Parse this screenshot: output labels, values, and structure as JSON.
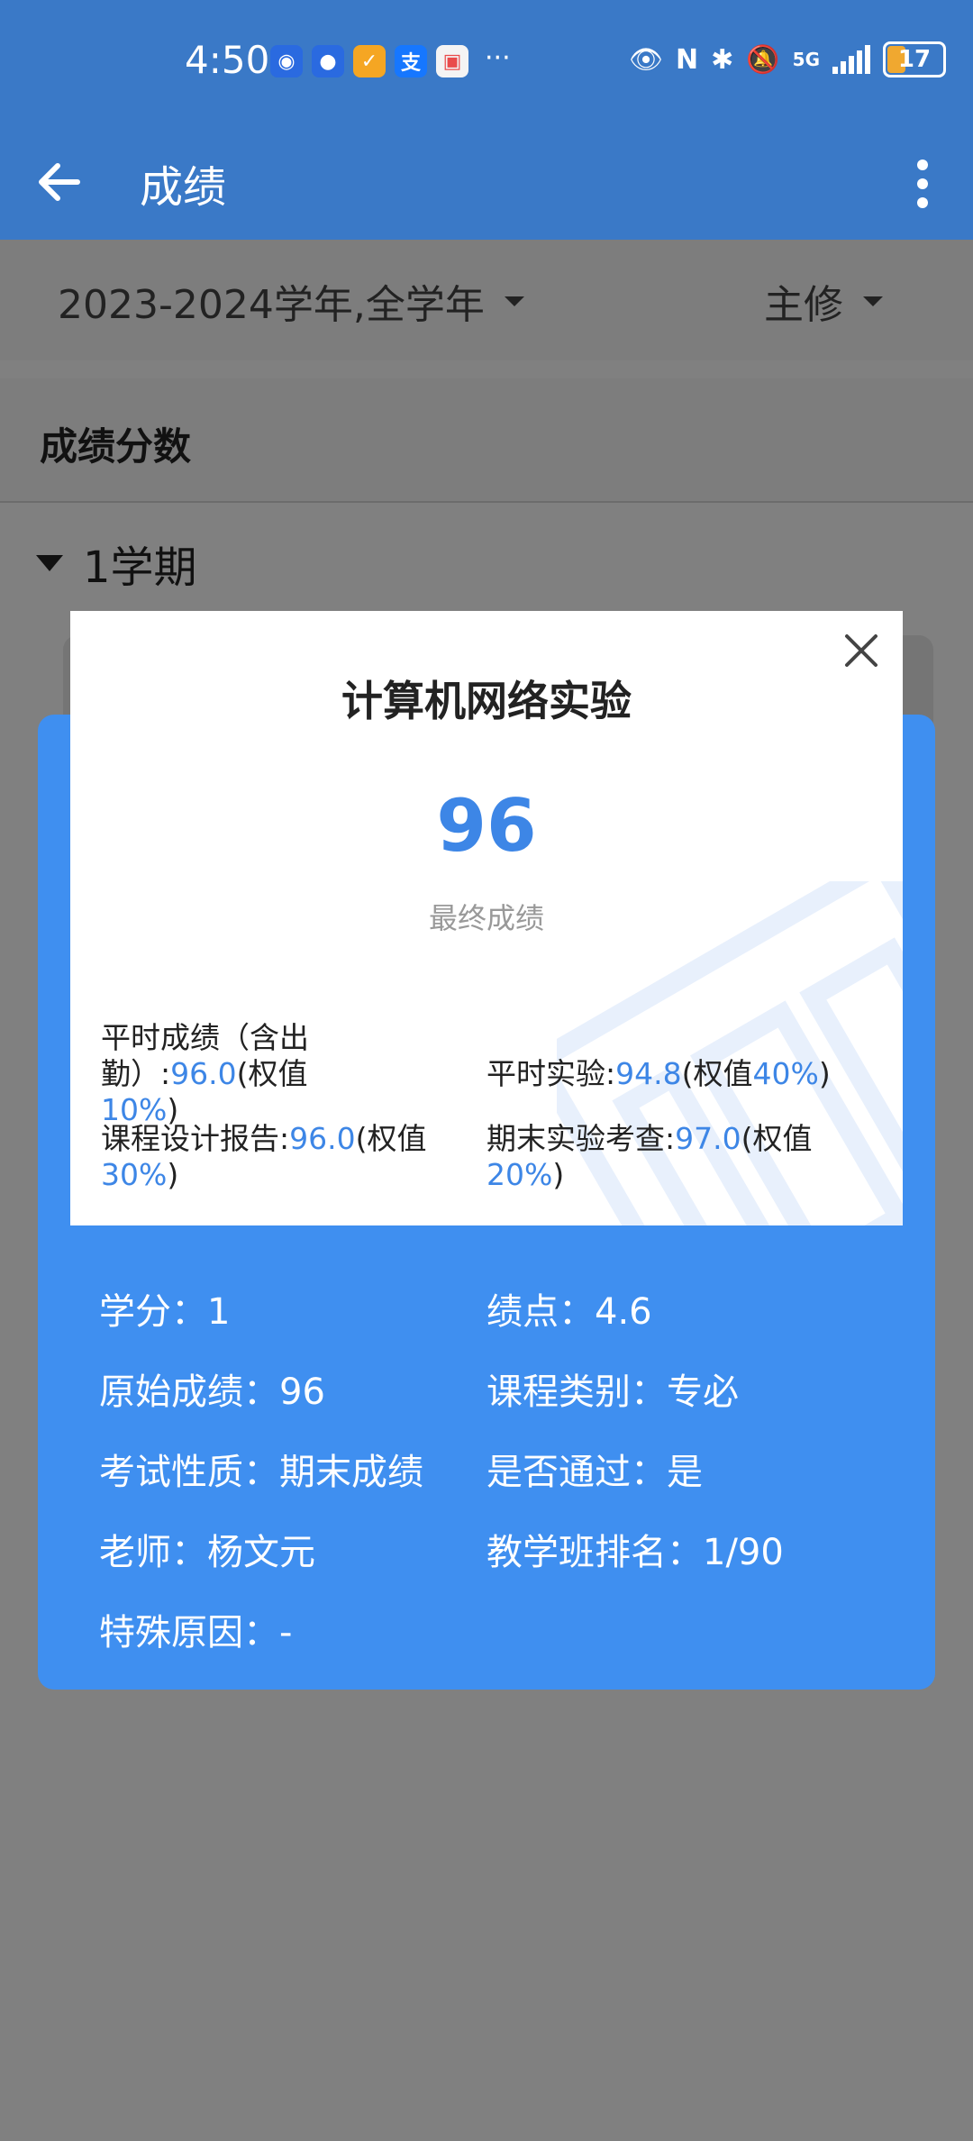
{
  "status_bar": {
    "time": "4:50",
    "notifications": [
      {
        "icon": "app-a-icon",
        "color": "#2a6ae0",
        "glyph": "◉"
      },
      {
        "icon": "qq-icon",
        "color": "#2a6ae0",
        "glyph": "●"
      },
      {
        "icon": "app-c-icon",
        "color": "#f5a623",
        "glyph": "✓"
      },
      {
        "icon": "alipay-icon",
        "color": "#1677ff",
        "glyph": "支"
      },
      {
        "icon": "calendar-icon",
        "color": "#e94b4b",
        "glyph": "▣"
      }
    ],
    "more": "···",
    "network": "5G",
    "battery": "17"
  },
  "app_bar": {
    "title": "成绩"
  },
  "filters": {
    "year": "2023-2024学年,全学年",
    "major": "主修"
  },
  "section": {
    "title": "成绩分数",
    "term": "1学期"
  },
  "modal": {
    "course_name": "计算机网络实验",
    "final_score": "96",
    "final_label": "最终成绩",
    "components": [
      {
        "name": "平时成绩（含出勤）",
        "score": "96.0",
        "weight": "10%"
      },
      {
        "name": "平时实验",
        "score": "94.8",
        "weight": "40%"
      },
      {
        "name": "课程设计报告",
        "score": "96.0",
        "weight": "30%"
      },
      {
        "name": "期末实验考查",
        "score": "97.0",
        "weight": "20%"
      }
    ],
    "weight_prefix": "(权值",
    "weight_suffix": ")"
  },
  "details": {
    "credit": "学分：1",
    "gpa": "绩点：4.6",
    "raw_score": "原始成绩：96",
    "course_type": "课程类别：专必",
    "exam_nature": "考试性质：期末成绩",
    "passed": "是否通过：是",
    "teacher": "老师：杨文元",
    "class_rank": "教学班排名：1/90",
    "special_reason": "特殊原因：-"
  },
  "colors": {
    "primary": "#3a79c7",
    "card": "#3f8ff0",
    "accent": "#3d86e6"
  }
}
